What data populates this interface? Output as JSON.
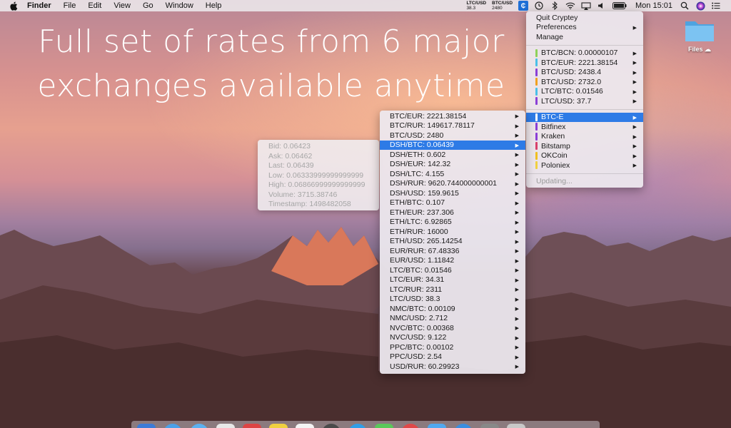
{
  "menubar": {
    "app_name": "Finder",
    "items": [
      "File",
      "Edit",
      "View",
      "Go",
      "Window",
      "Help"
    ],
    "tickers": [
      {
        "pair": "LTC/USD",
        "value": "38.3"
      },
      {
        "pair": "BTC/USD",
        "value": "2480"
      }
    ],
    "clock": "Mon 15:01",
    "status_icons": [
      "cryptey-icon",
      "time-machine-icon",
      "bluetooth-icon",
      "wifi-icon",
      "airplay-icon",
      "volume-icon",
      "battery-icon",
      "search-icon",
      "siri-icon",
      "list-icon"
    ]
  },
  "headline": {
    "line1": "Full set of rates from 6 major",
    "line2": "exchanges available anytime"
  },
  "desktop": {
    "folder_label": "Files"
  },
  "main_menu": {
    "quit": "Quit Cryptey",
    "preferences": "Preferences",
    "manage": "Manage",
    "rates": [
      {
        "label": "BTC/BCN: 0.00000107",
        "color": "#8fd15a"
      },
      {
        "label": "BTC/EUR: 2221.38154",
        "color": "#4ac0e8"
      },
      {
        "label": "BTC/USD: 2438.4",
        "color": "#8b3fd6"
      },
      {
        "label": "BTC/USD: 2732.0",
        "color": "#f0a020"
      },
      {
        "label": "LTC/BTC: 0.01546",
        "color": "#4ac0e8"
      },
      {
        "label": "LTC/USD: 37.7",
        "color": "#8b3fd6"
      }
    ],
    "exchanges": [
      {
        "label": "BTC-E",
        "color": "#2e7be6"
      },
      {
        "label": "Bitfinex",
        "color": "#8b3fd6"
      },
      {
        "label": "Kraken",
        "color": "#8b3fd6"
      },
      {
        "label": "Bitstamp",
        "color": "#d8406a"
      },
      {
        "label": "OKCoin",
        "color": "#f0c020"
      },
      {
        "label": "Poloniex",
        "color": "#f0d040"
      }
    ],
    "status": "Updating..."
  },
  "pairs_menu": {
    "highlighted_index": 3,
    "items": [
      "BTC/EUR: 2221.38154",
      "BTC/RUR: 149617.78117",
      "BTC/USD: 2480",
      "DSH/BTC: 0.06439",
      "DSH/ETH: 0.602",
      "DSH/EUR: 142.32",
      "DSH/LTC: 4.155",
      "DSH/RUR: 9620.744000000001",
      "DSH/USD: 159.9615",
      "ETH/BTC: 0.107",
      "ETH/EUR: 237.306",
      "ETH/LTC: 6.92865",
      "ETH/RUR: 16000",
      "ETH/USD: 265.14254",
      "EUR/RUR: 67.48336",
      "EUR/USD: 1.11842",
      "LTC/BTC: 0.01546",
      "LTC/EUR: 34.31",
      "LTC/RUR: 2311",
      "LTC/USD: 38.3",
      "NMC/BTC: 0.00109",
      "NMC/USD: 2.712",
      "NVC/BTC: 0.00368",
      "NVC/USD: 9.122",
      "PPC/BTC: 0.00102",
      "PPC/USD: 2.54",
      "USD/RUR: 60.29923"
    ]
  },
  "tooltip": {
    "lines": [
      "Bid: 0.06423",
      "Ask: 0.06462",
      "Last: 0.06439",
      "Low: 0.06333999999999999",
      "High: 0.06866999999999999",
      "Volume: 3715.38746",
      "Timestamp: 1498482058"
    ]
  },
  "colors": {
    "highlight": "#2e7be6",
    "folder": "#6fb9ee"
  }
}
